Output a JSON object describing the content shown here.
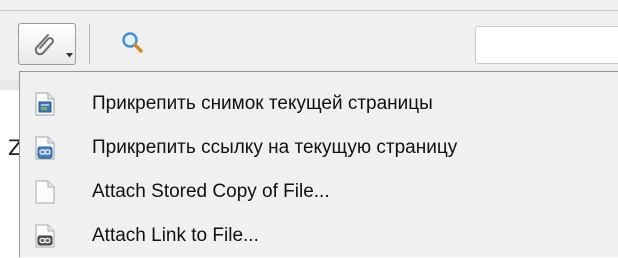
{
  "menu": {
    "items": [
      {
        "label": "Прикрепить снимок текущей страницы",
        "icon": "page-snapshot-icon"
      },
      {
        "label": "Прикрепить ссылку на текущую страницу",
        "icon": "page-link-icon"
      },
      {
        "label": "Attach Stored Copy of File...",
        "icon": "blank-file-icon"
      },
      {
        "label": "Attach Link to File...",
        "icon": "file-link-icon"
      }
    ]
  },
  "background": {
    "partial_letter": "Z"
  },
  "toolbar": {
    "attach_icon": "paperclip-icon",
    "search_icon": "magnifier-icon",
    "search_value": ""
  }
}
